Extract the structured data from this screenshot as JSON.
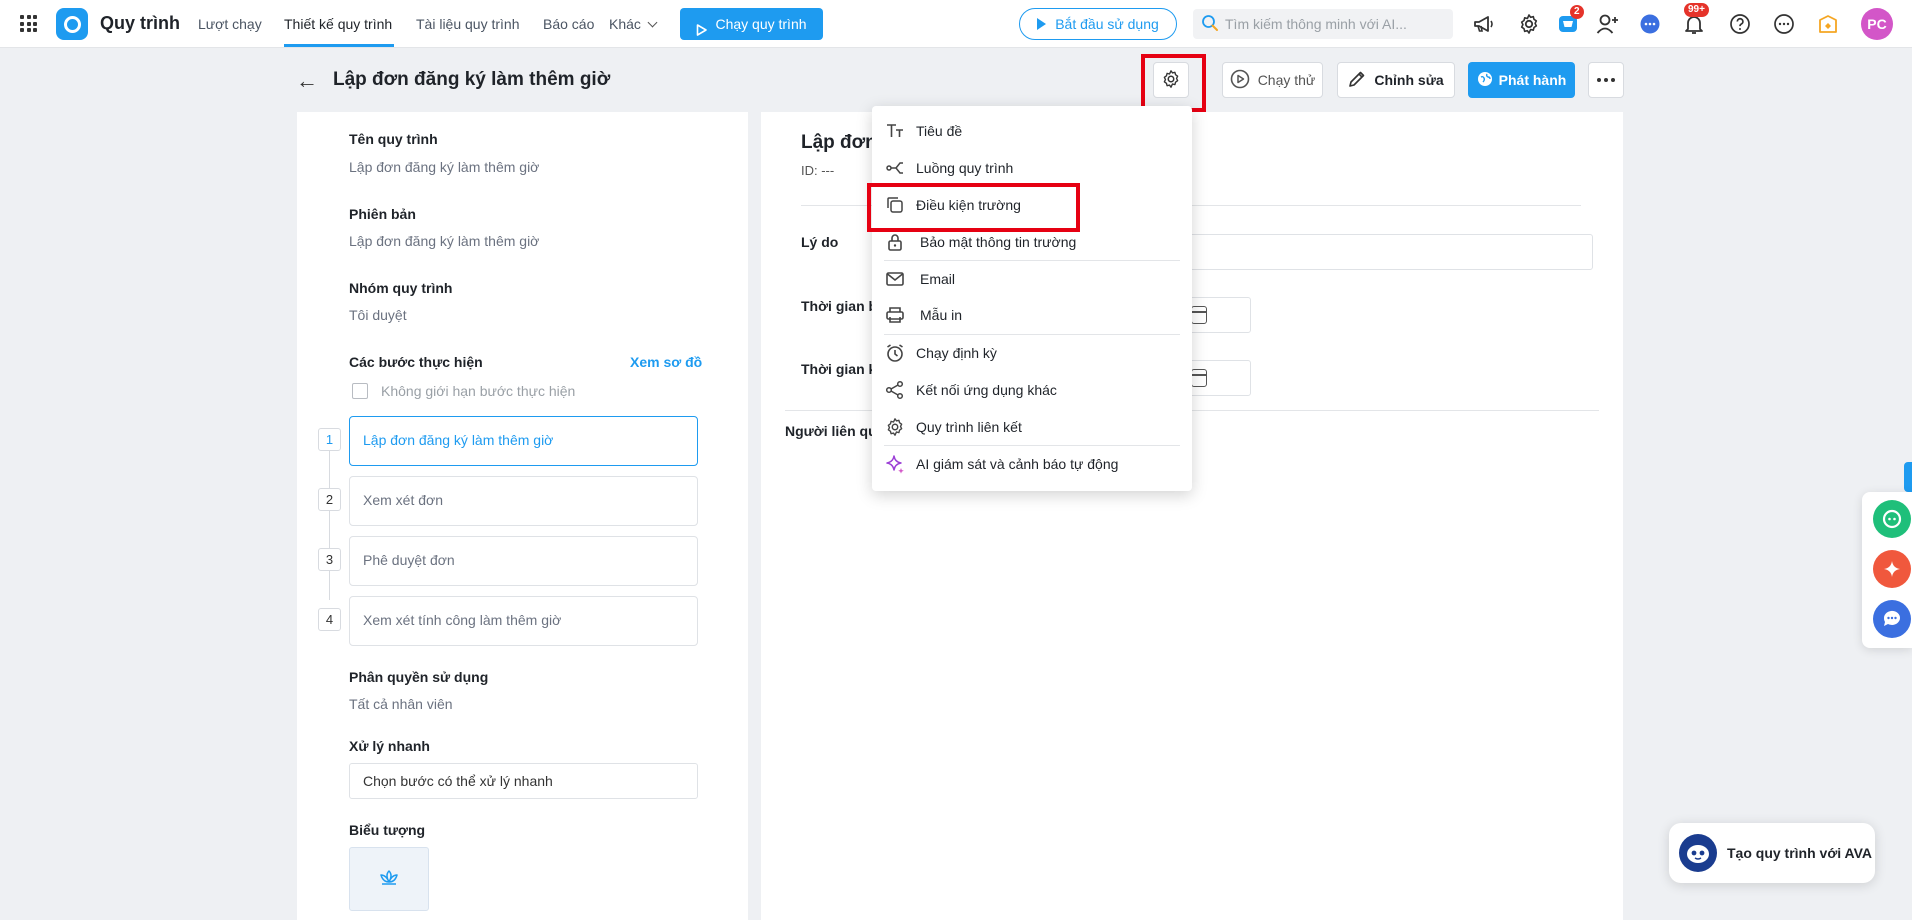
{
  "app": {
    "title": "Quy trình"
  },
  "nav": {
    "items": [
      "Lượt chạy",
      "Thiết kế quy trình",
      "Tài liệu quy trình",
      "Báo cáo",
      "Khác"
    ],
    "run_button": "Chạy quy trình"
  },
  "topbar": {
    "start_button": "Bắt đầu sử dụng",
    "search_placeholder": "Tìm kiếm thông minh với AI...",
    "cart_badge": "2",
    "bell_badge": "99+",
    "avatar": "PC"
  },
  "header": {
    "title": "Lập đơn đăng ký làm thêm giờ",
    "test_run": "Chạy thử",
    "edit": "Chỉnh sửa",
    "publish": "Phát hành"
  },
  "left": {
    "name_label": "Tên quy trình",
    "name_value": "Lập đơn đăng ký làm thêm giờ",
    "version_label": "Phiên bản",
    "version_value": "Lập đơn đăng ký làm thêm giờ",
    "group_label": "Nhóm quy trình",
    "group_value": "Tôi duyệt",
    "steps_label": "Các bước thực hiện",
    "view_diagram": "Xem sơ đồ",
    "unlimited_steps": "Không giới hạn bước thực hiện",
    "steps": [
      {
        "num": "1",
        "label": "Lập đơn đăng ký làm thêm giờ"
      },
      {
        "num": "2",
        "label": "Xem xét đơn"
      },
      {
        "num": "3",
        "label": "Phê duyệt đơn"
      },
      {
        "num": "4",
        "label": "Xem xét tính công làm thêm giờ"
      }
    ],
    "permission_label": "Phân quyền sử dụng",
    "permission_value": "Tất cả nhân viên",
    "quick_label": "Xử lý nhanh",
    "quick_value": "Chọn bước có thể xử lý nhanh",
    "icon_label": "Biểu tượng"
  },
  "form": {
    "title": "Lập đơn",
    "id": "ID:  ---",
    "reason": "Lý do",
    "start_time": "Thời gian b",
    "end_time": "Thời gian k",
    "related": "Người liên quan"
  },
  "menu": {
    "items": [
      {
        "label": "Tiêu đề",
        "icon": "text-icon"
      },
      {
        "label": "Luồng quy trình",
        "icon": "flow-icon"
      },
      {
        "label": "Điều kiện trường",
        "icon": "copy-icon"
      },
      {
        "label": "Bảo mật thông tin trường",
        "icon": "lock-icon"
      },
      {
        "label": "Email",
        "icon": "mail-icon"
      },
      {
        "label": "Mẫu in",
        "icon": "printer-icon"
      },
      {
        "label": "Chạy định kỳ",
        "icon": "alarm-icon"
      },
      {
        "label": "Kết nối ứng dụng khác",
        "icon": "share-icon"
      },
      {
        "label": "Quy trình liên kết",
        "icon": "gear-link-icon"
      },
      {
        "label": "AI giám sát và cảnh báo tự động",
        "icon": "sparkle-icon"
      }
    ]
  },
  "ava": {
    "label": "Tạo quy trình với AVA"
  },
  "colors": {
    "accent": "#1e9bf0",
    "highlight": "#e60012"
  }
}
